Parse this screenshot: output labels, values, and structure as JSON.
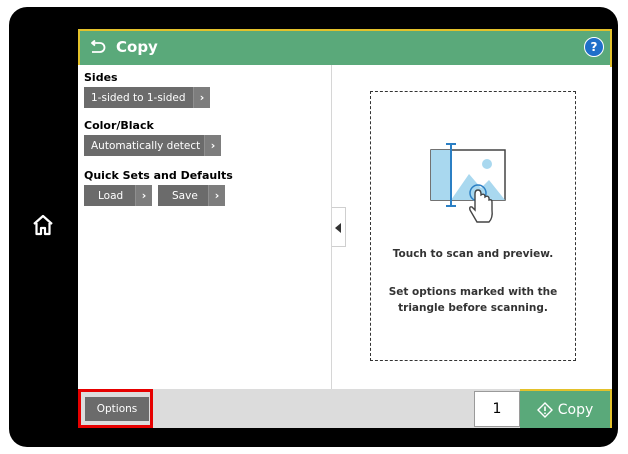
{
  "header": {
    "title": "Copy",
    "help": "?"
  },
  "settings": {
    "sides_label": "Sides",
    "sides_value": "1-sided to 1-sided",
    "color_label": "Color/Black",
    "color_value": "Automatically detect",
    "quicksets_label": "Quick Sets and Defaults",
    "load_label": "Load",
    "save_label": "Save"
  },
  "preview": {
    "line1": "Touch to scan and preview.",
    "line2": "Set options marked with the triangle before scanning."
  },
  "footer": {
    "options_label": "Options",
    "copies": "1",
    "copy_label": "Copy"
  },
  "icons": {
    "home": "home-icon",
    "back": "back-arrow-icon",
    "help": "help-icon",
    "arrow": "chevron-right-icon",
    "copy": "copy-start-icon",
    "preview": "scan-preview-icon"
  },
  "colors": {
    "header_green": "#5aa97a",
    "accent_yellow": "#e3c12b",
    "button_gray": "#6b6b6b",
    "highlight_red": "#e60000",
    "help_blue": "#1f6fc9"
  }
}
